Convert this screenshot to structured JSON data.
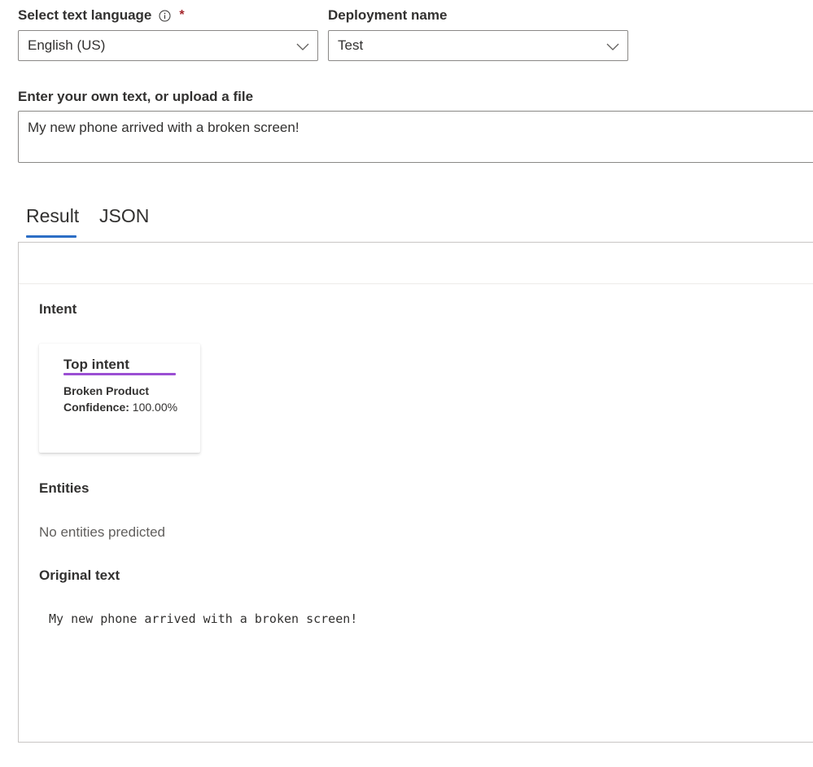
{
  "form": {
    "language_label": "Select text language",
    "required_mark": "*",
    "language_value": "English (US)",
    "deployment_label": "Deployment name",
    "deployment_value": "Test",
    "text_label": "Enter your own text, or upload a file",
    "text_value": "My new phone arrived with a broken screen!"
  },
  "tabs": [
    {
      "label": "Result",
      "active": true
    },
    {
      "label": "JSON",
      "active": false
    }
  ],
  "result": {
    "intent_title": "Intent",
    "card": {
      "title": "Top intent",
      "intent_name": "Broken Product",
      "confidence_label": "Confidence:",
      "confidence_value": "100.00%"
    },
    "entities_title": "Entities",
    "entities_empty": "No entities predicted",
    "original_text_title": "Original text",
    "original_text": "My new phone arrived with a broken screen!"
  },
  "icons": {
    "info": "info-icon",
    "chevron": "chevron-down-icon"
  },
  "colors": {
    "tab_underline": "#2c6ec5",
    "card_accent": "#9b4fd3",
    "required": "#a4262c"
  }
}
